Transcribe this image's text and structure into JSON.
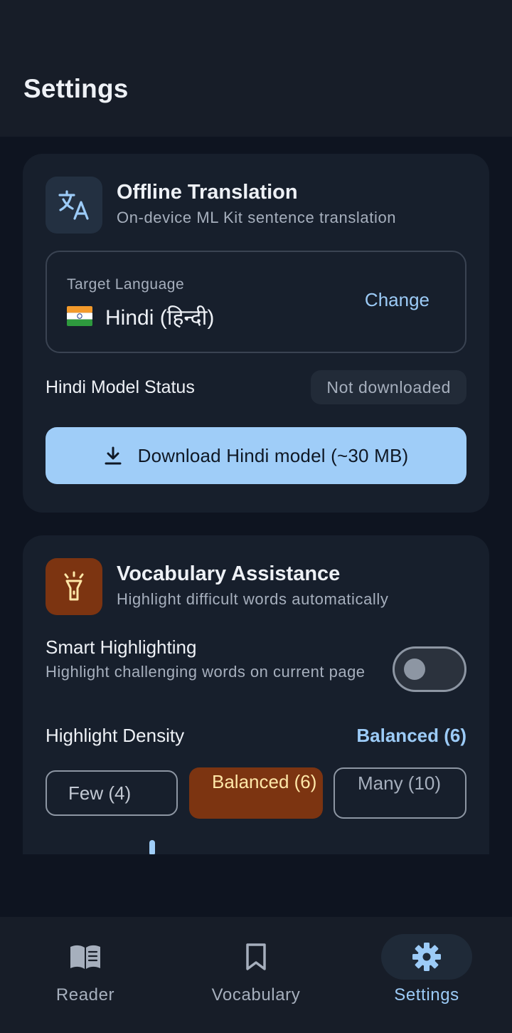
{
  "header": {
    "title": "Settings"
  },
  "offline_translation": {
    "title": "Offline Translation",
    "subtitle": "On-device ML Kit sentence translation",
    "icon": "translate-icon",
    "target_language_label": "Target Language",
    "target_language_value": "Hindi (हिन्दी)",
    "flag": "india-flag-icon",
    "change_label": "Change",
    "model_status_label": "Hindi Model Status",
    "model_status_value": "Not downloaded",
    "download_label": "Download Hindi model (~30 MB)"
  },
  "vocabulary_assistance": {
    "title": "Vocabulary Assistance",
    "subtitle": "Highlight difficult words automatically",
    "icon": "flashlight-icon",
    "smart_title": "Smart Highlighting",
    "smart_desc": "Highlight challenging words on current page",
    "smart_enabled": false,
    "density_label": "Highlight Density",
    "density_value": "Balanced (6)",
    "options": [
      {
        "label": "Few (4)",
        "selected": false
      },
      {
        "label": "Balanced (6)",
        "selected": true
      },
      {
        "label": "Many (10)",
        "selected": false
      }
    ]
  },
  "bottom_nav": {
    "items": [
      {
        "label": "Reader",
        "icon": "book-open-icon",
        "active": false
      },
      {
        "label": "Vocabulary",
        "icon": "bookmark-icon",
        "active": false
      },
      {
        "label": "Settings",
        "icon": "gear-icon",
        "active": true
      }
    ]
  },
  "colors": {
    "background": "#0e1420",
    "card": "#171f2c",
    "accent": "#9fcdf8",
    "orange": "#7c3411"
  }
}
